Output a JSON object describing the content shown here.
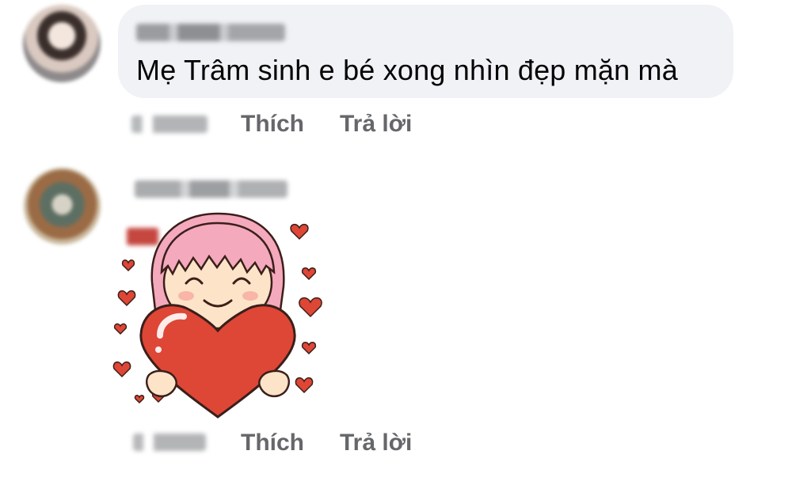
{
  "comments": [
    {
      "author": "Nguyễn Trâm",
      "text": "Mẹ Trâm sinh e bé xong nhìn đẹp mặn mà",
      "actions": {
        "like": "Thích",
        "reply": "Trả lời"
      }
    },
    {
      "author": "",
      "sticker": "girl-hugging-heart-sticker",
      "actions": {
        "like": "Thích",
        "reply": "Trả lời"
      }
    }
  ],
  "colors": {
    "bubble": "#f0f2f5",
    "text": "#050505",
    "secondary": "#65676b",
    "heart": "#de4636",
    "hair": "#f4a9bd"
  }
}
